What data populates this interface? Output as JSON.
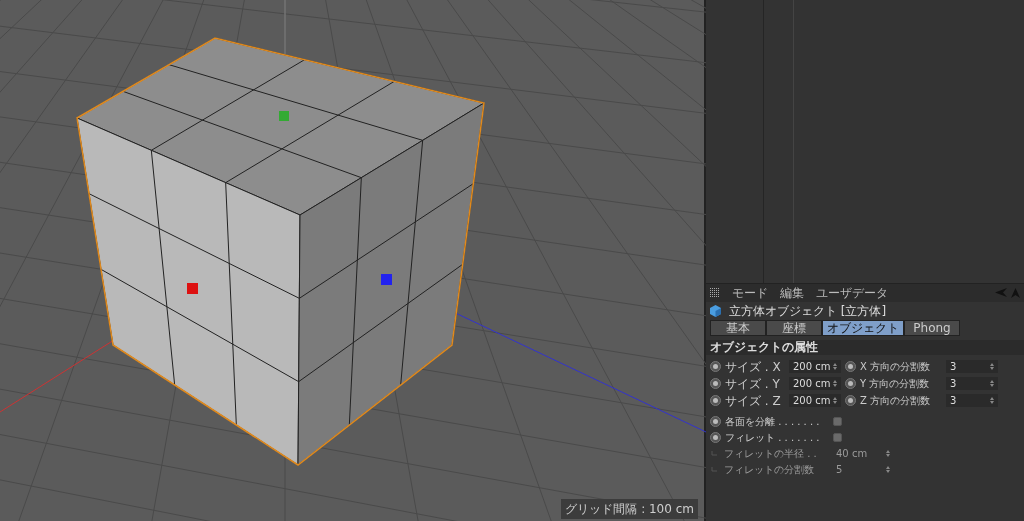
{
  "viewport": {
    "grid_label": "グリッド間隔 : 100 cm"
  },
  "attributes": {
    "menu": [
      "モード",
      "編集",
      "ユーザデータ"
    ],
    "object_title": "立方体オブジェクト [立方体]",
    "tabs": [
      {
        "label": "基本",
        "selected": false
      },
      {
        "label": "座標",
        "selected": false
      },
      {
        "label": "オブジェクト",
        "selected": true
      },
      {
        "label": "Phong",
        "selected": false
      }
    ],
    "section_title": "オブジェクトの属性",
    "params": [
      {
        "label": "サイズ . X",
        "value": "200 cm",
        "pair_label": "X 方向の分割数",
        "pair_value": "3"
      },
      {
        "label": "サイズ . Y",
        "value": "200 cm",
        "pair_label": "Y 方向の分割数",
        "pair_value": "3"
      },
      {
        "label": "サイズ . Z",
        "value": "200 cm",
        "pair_label": "Z 方向の分割数",
        "pair_value": "3"
      }
    ],
    "options": [
      {
        "kind": "checkbox",
        "label": "各面を分離 . . . . . . .",
        "checked": false,
        "disabled": false
      },
      {
        "kind": "checkbox",
        "label": "フィレット . . . . . . .",
        "checked": false,
        "disabled": false
      },
      {
        "kind": "number",
        "label": "フィレットの半径 . .",
        "value": "40 cm",
        "disabled": true
      },
      {
        "kind": "number",
        "label": "フィレットの分割数",
        "value": "5",
        "disabled": true
      }
    ]
  }
}
